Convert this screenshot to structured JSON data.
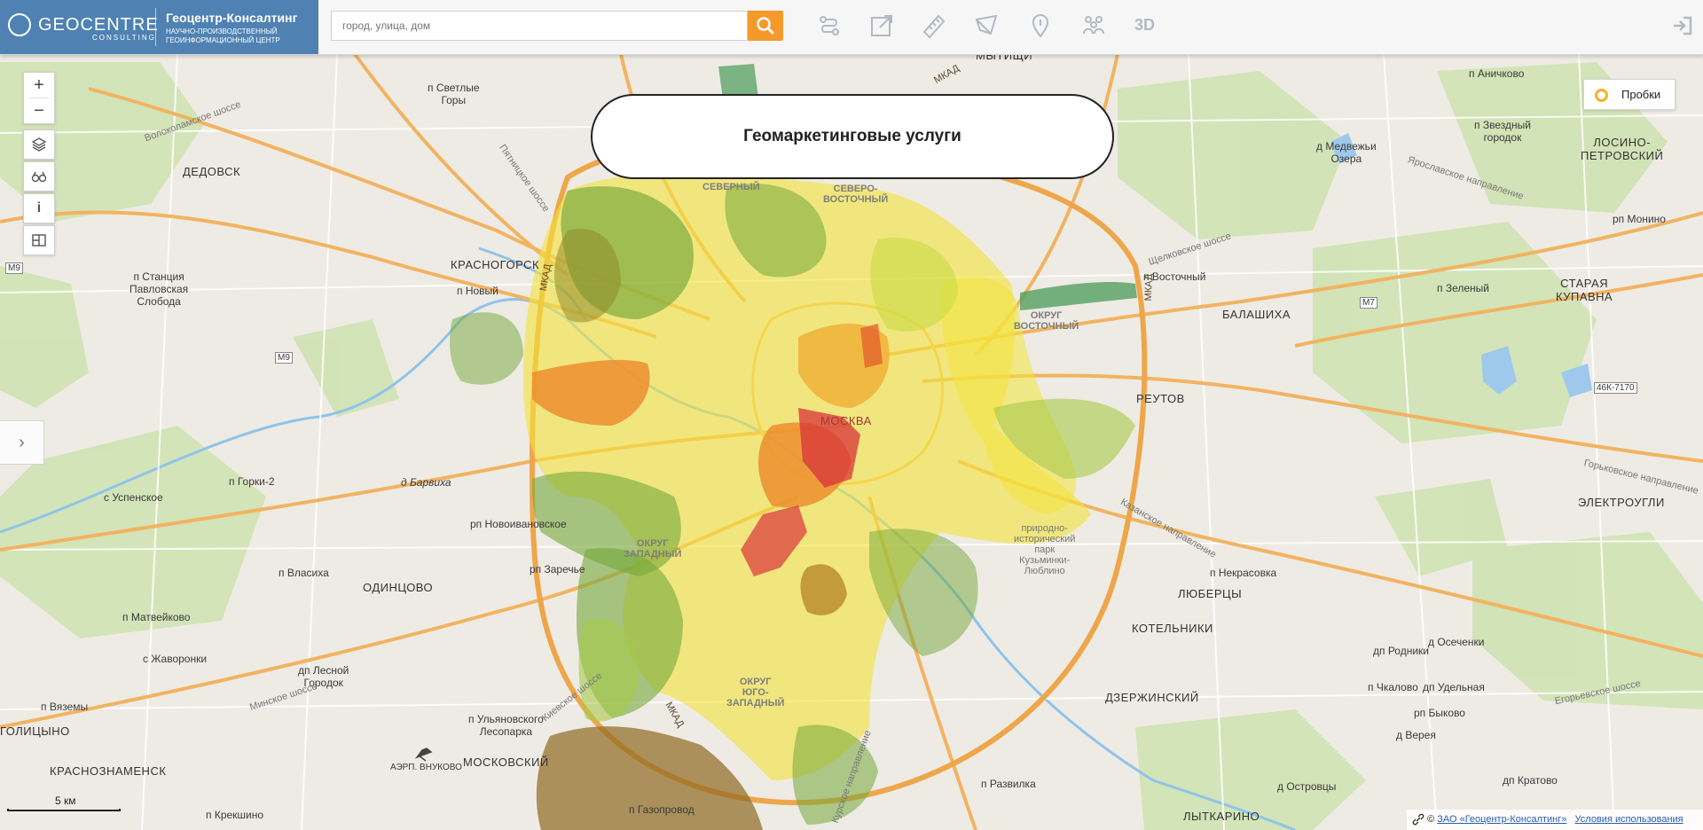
{
  "brand": {
    "logo_word": "GEOCENTRE",
    "logo_sub": "CONSULTING",
    "title": "Геоцентр-Консалтинг",
    "tagline1": "НАУЧНО-ПРОИЗВОДСТВЕННЫЙ",
    "tagline2": "ГЕОИНФОРМАЦИОННЫЙ ЦЕНТР"
  },
  "search": {
    "placeholder": "город, улица, дом",
    "button_icon": "search-icon"
  },
  "toolbar": {
    "tools": [
      "route-icon",
      "share-icon",
      "ruler-icon",
      "area-measure-icon",
      "placemark-icon",
      "people-icon"
    ],
    "label_3d": "3D",
    "login_icon": "login-icon"
  },
  "map_controls": {
    "zoom_in": "+",
    "zoom_out": "−",
    "info": "i",
    "layers_icon": "layers-icon",
    "binoculars_icon": "binoculars-icon",
    "panorama_icon": "panorama-icon",
    "side_arrow": "›"
  },
  "title_box": {
    "text": "Геомаркетинговые услуги"
  },
  "traffic": {
    "label": "Пробки",
    "color": "#f3b32a"
  },
  "scale": {
    "label": "5 км"
  },
  "attribution": {
    "prefix": "©",
    "owner": "ЗАО «Геоцентр-Консалтинг»",
    "terms": "Условия использования"
  },
  "colors": {
    "accent": "#4f82b3",
    "search_button": "#f39a2b",
    "heat_red": "#d8333a",
    "heat_orange": "#ee8a2a",
    "heat_yellow": "#f3e33a",
    "heat_lightgreen": "#a7c94a",
    "heat_green": "#74a83a",
    "heat_brown": "#8f6a22"
  },
  "map_labels": {
    "moscow": "МОСКВА",
    "krasnogorsk": "КРАСНОГОРСК",
    "dedovsk": "ДЕДОВСК",
    "odintsovo": "ОДИНЦОВО",
    "krasnoznamensk": "КРАСНОЗНАМЕНСК",
    "golitsyno": "ГОЛИЦЫНО",
    "balashikha": "БАЛАШИХА",
    "reutov": "РЕУТОВ",
    "lyubertsy": "ЛЮБЕРЦЫ",
    "kotelniki": "КОТЕЛЬНИКИ",
    "dzerzhinsky": "ДЗЕРЖИНСКИЙ",
    "lytkarino": "ЛЫТКАРИНО",
    "elektrougli": "ЭЛЕКТРОУГЛИ",
    "staraya_kupavna": "СТАРАЯ\nКУПАВНА",
    "losino": "ЛОСИНО-\nПЕТРОВСКИЙ",
    "mytishchi": "МЫТИЩИ",
    "moskovsky": "МОСКОВСКИЙ",
    "district_north": "СЕВЕРНЫЙ",
    "district_ne": "СЕВЕРО-\nВОСТОЧНЫЙ",
    "district_east": "ОКРУГ\nВОСТОЧНЫЙ",
    "district_west": "ОКРУГ\nЗАПАДНЫЙ",
    "district_sw": "ОКРУГ\nЮГО-\nЗАПАДНЫЙ",
    "mkad": "МКАД",
    "m9": "M9",
    "m7": "M7",
    "road_46k": "46К-7170",
    "p_novy": "п Новый",
    "p_stantsiya": "п Станция\nПавловская\nСлобода",
    "p_svetlye": "п Светлые\nГоры",
    "p_gorki": "п Горки-2",
    "p_barvikha": "д Барвиха",
    "p_usenskoe": "с Успенское",
    "p_novoivankovskoe": "рп Новоивановское",
    "p_zarechye": "рп Заречье",
    "p_vlasikha": "п Власиха",
    "p_matveikovo": "п Матвейково",
    "p_zhavoronki": "с Жаворонки",
    "p_lesnoy": "дп Лесной\nГородок",
    "p_vyazemy": "п Вяземы",
    "p_krekshino": "п Крекшино",
    "p_ulyanovskogo": "п Ульяновского\nЛесопарка",
    "p_gazoprovod": "п Газопровод",
    "airport": "АЭРП. ВНУКОВО",
    "p_vostochny": "п Восточный",
    "p_zeleny": "п Зеленый",
    "p_monino": "рп Монино",
    "p_anichkovo": "п Аничково",
    "p_medvezhyi": "д Медвежьи\nОзера",
    "p_zvezdny": "п Звездный\nгородок",
    "p_nekrasovka": "п Некрасовка",
    "p_osechki": "д Осеченки",
    "p_rodniki": "дп Родники",
    "p_chkalovo": "п Чкалово",
    "p_udelnaya": "дп Удельная",
    "p_bykovo": "рп Быково",
    "p_vereya": "д Верея",
    "p_ostrovtsy": "д Островцы",
    "p_kratovo": "дп Кратово",
    "p_razvilka": "п Развилка",
    "kuzminki": "природно-\nисторический\nпарк\nКузьминки-\nЛюблино",
    "egorevskoe": "Егорьевское шоссе",
    "shchelkovskoe": "Щелковское шоссе",
    "volokolamskoe": "Волоколамское шоссе",
    "minskoe": "Минское шоссе",
    "kievskoe": "Киевское шоссе",
    "kazanskoe": "Казанское направление",
    "yaroslavskoe": "Ярославское направление",
    "gorkovskoe": "Горьковское направление",
    "pyatnitskoe": "Пятницкое шоссе",
    "kurskoe": "Курское направление"
  }
}
